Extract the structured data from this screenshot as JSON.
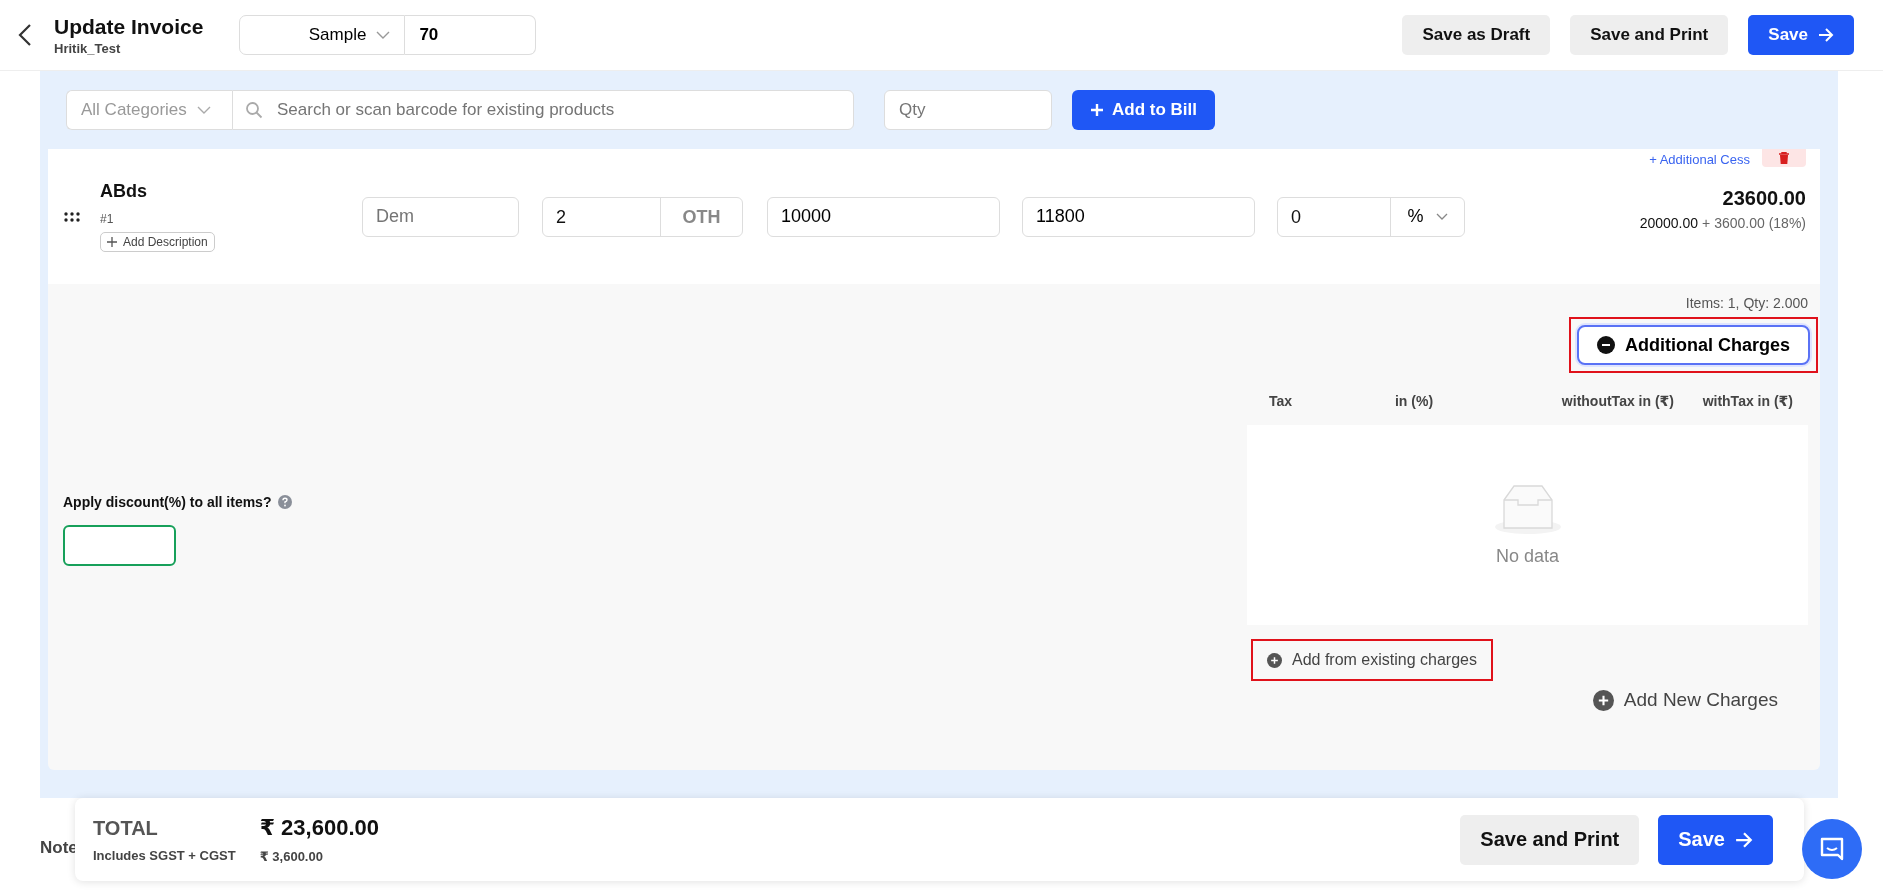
{
  "header": {
    "title": "Update Invoice",
    "subtitle": "Hritik_Test",
    "series": {
      "value": "Sample"
    },
    "number": {
      "value": "70"
    },
    "actions": [
      {
        "label": "Save as Draft",
        "kind": "secondary"
      },
      {
        "label": "Save and Print",
        "kind": "secondary"
      },
      {
        "label": "Save",
        "kind": "primary"
      }
    ]
  },
  "product_search": {
    "category": {
      "value": "All Categories"
    },
    "search": {
      "placeholder": "Search or scan barcode for existing products"
    },
    "qty": {
      "placeholder": "Qty"
    },
    "add_button": {
      "label": "Add to Bill"
    }
  },
  "items": [
    {
      "name": "ABds",
      "index": "#1",
      "add_description": "Add Description",
      "additional_cess": "+ Additional Cess",
      "description": {
        "placeholder": "Dem"
      },
      "qty": "2",
      "unit": "OTH",
      "price": "10000",
      "price_with_tax": "11800",
      "discount": "0",
      "discount_type": "%",
      "total": "23600.00",
      "net": "20000.00",
      "tax": "+ 3600.00 (18%)"
    }
  ],
  "summary": {
    "items_count": "Items: 1, Qty: 2.000"
  },
  "discount_all": {
    "label": "Apply discount(%) to all items?"
  },
  "additional_charges": {
    "toggle": {
      "label": "Additional Charges",
      "expanded": true,
      "highlighted": true
    },
    "columns": [
      "Tax",
      "in (%)",
      "withoutTax in (₹)",
      "withTax in (₹)"
    ],
    "empty_text": "No data",
    "links": [
      {
        "label": "Add from existing charges",
        "highlighted": true
      },
      {
        "label": "Add New Charges",
        "highlighted": false
      }
    ]
  },
  "notes": {
    "label": "Note"
  },
  "footer": {
    "total_label": "TOTAL",
    "total": "₹ 23,600.00",
    "tax_label": "Includes SGST + CGST",
    "tax": "₹ 3,600.00",
    "actions": [
      {
        "label": "Save and Print",
        "kind": "secondary"
      },
      {
        "label": "Save",
        "kind": "primary"
      }
    ]
  }
}
